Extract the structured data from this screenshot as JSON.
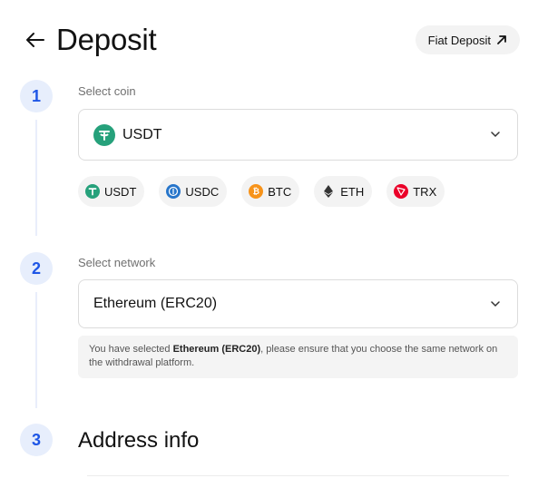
{
  "header": {
    "title": "Deposit",
    "fiat_deposit_label": "Fiat Deposit"
  },
  "steps": [
    {
      "number": "1",
      "label": "Select coin"
    },
    {
      "number": "2",
      "label": "Select network"
    },
    {
      "number": "3",
      "title": "Address info"
    }
  ],
  "coin_select": {
    "value": "USDT",
    "icon": "tether-icon",
    "icon_color": "#26a17b"
  },
  "quick_coins": [
    {
      "label": "USDT",
      "icon": "tether-icon",
      "color": "#26a17b"
    },
    {
      "label": "USDC",
      "icon": "usdc-icon",
      "color": "#2775ca"
    },
    {
      "label": "BTC",
      "icon": "bitcoin-icon",
      "color": "#f7931a"
    },
    {
      "label": "ETH",
      "icon": "ethereum-icon",
      "color": "#343434"
    },
    {
      "label": "TRX",
      "icon": "tron-icon",
      "color": "#eb0029"
    }
  ],
  "network_select": {
    "value": "Ethereum (ERC20)"
  },
  "network_notice": {
    "prefix": "You have selected ",
    "network": "Ethereum (ERC20)",
    "suffix": ", please ensure that you choose the same network on the withdrawal platform."
  },
  "colors": {
    "accent": "#1e56e6",
    "step_bg": "#e7eefc",
    "chip_bg": "#f3f3f3"
  }
}
